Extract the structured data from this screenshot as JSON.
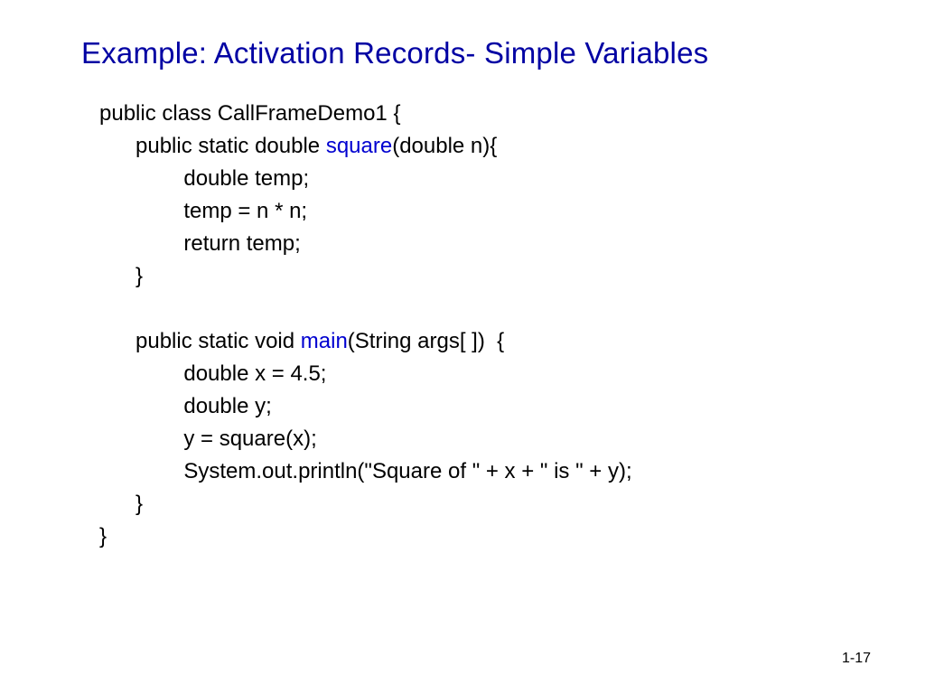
{
  "title": "Example: Activation Records- Simple Variables",
  "code": {
    "line1a": "public class CallFrameDemo1 {",
    "line2a": "      public static double ",
    "line2b": "square",
    "line2c": "(double n){",
    "line3": "              double temp;",
    "line4": "              temp = n * n;",
    "line5": "              return temp;",
    "line6": "      }",
    "line7": "",
    "line8a": "      public static void ",
    "line8b": "main",
    "line8c": "(String args[ ])  {",
    "line9": "              double x = 4.5;",
    "line10": "              double y;",
    "line11": "              y = square(x);",
    "line12": "              System.out.println(\"Square of \" + x + \" is \" + y);",
    "line13": "      }",
    "line14": "}"
  },
  "pageNumber": "1-17"
}
